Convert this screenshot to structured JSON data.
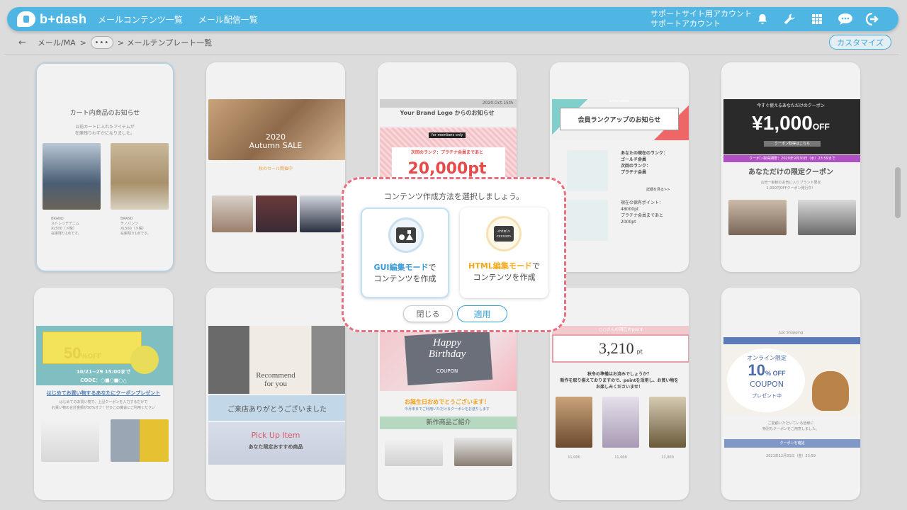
{
  "app": {
    "logo_text": "b+dash",
    "nav": [
      "メールコンテンツ一覧",
      "メール配信一覧"
    ],
    "account_line1": "サポートサイト用アカウント",
    "account_line2": "サポートアカウント",
    "icons": [
      "bell-icon",
      "wrench-icon",
      "grid-icon",
      "chat-icon",
      "logout-icon"
    ]
  },
  "breadcrumb": {
    "back": "←",
    "item1": "メール/MA",
    "sep": ">",
    "more": "•••",
    "current": "> メールテンプレート一覧",
    "customize_label": "カスタマイズ"
  },
  "cards": {
    "c1": {
      "title": "カート内商品のお知らせ",
      "sub": "以前カートに入れたアイテムが\n在庫残りわずかになりました。",
      "brand1": "BRAND\nストレッチデニム\nXL500（メ税）\n在庫残り1点です。",
      "brand2": "BRAND\nチノパンツ\nXL500（メ税）\n在庫残り1点です。"
    },
    "c2": {
      "banner": "2020\nAutumn SALE",
      "sub": "秋のセール開催中"
    },
    "c3": {
      "date": "2020.Oct.15th",
      "logo": "Your Brand Logo からのお知らせ",
      "members": "for members only",
      "rank": "次回のランク：プラチナ会員まであと",
      "points": "20,000pt"
    },
    "c4": {
      "info": "information",
      "title": "会員ランクアップのお知らせ",
      "rank_text": "あなたの現在のランク：\nゴールド会員\n次回のランク：\nプラチナ会員",
      "detail": "詳細を見る>>",
      "points_text": "現在の保有ポイント：\n48000pt\nプラチナ会員まであと\n2000pt"
    },
    "c5": {
      "top": "今すぐ使えるあなただけのクーポン",
      "amount": "¥1,000",
      "off": "OFF",
      "get": "クーポン取得はこちら",
      "deadline": "クーポン取得期限：2020年9月30日（水）23:59まで",
      "title": "あなただけの限定クーポン",
      "sub": "山田一郎様のお気に入りブランド限定\n1,000円OFFクーポン発行中！"
    },
    "c6": {
      "coupon": "WELCOME COUPON",
      "pct": "50",
      "off": "%OFF",
      "date": "10/21~29 15:00まで",
      "code": "CODE：○■○■○△",
      "title": "はじめてお買い物するあなたにクーポンプレゼント",
      "sub": "はじめてのお買い物で、上記クーポンを入力するだけで\nお買い物の合計金額が50%オフ！ぜひこの機会にご利用ください"
    },
    "c7": {
      "rec": "Recommend\nfor you",
      "thanks": "ご来店ありがとうございました",
      "pick": "Pick Up Item",
      "sub": "あなた限定おすすめ商品"
    },
    "c8": {
      "happy": "Happy\nBirthday",
      "coupon": "COUPON",
      "msg": "お誕生日おめでとうございます！",
      "msg2": "今月末までご利用いただけるクーポンをお送りします",
      "new": "新作商品ご紹介"
    },
    "c9": {
      "head": "○○さんの現在のpoint",
      "points": "3,210",
      "unit": "pt",
      "sub": "秋冬の準備はお済みでしょうか？\n新作を取り揃えておりますので、pointを活用し、お買い物を\nお楽しみくださいませ！",
      "price": "11,000"
    },
    "c10": {
      "shop": "Just Shopping",
      "online": "オンライン限定",
      "pct": "10",
      "off": "% OFF",
      "coupon": "COUPON",
      "present": "プレゼント中",
      "sub": "ご愛顧いただいている皆様に\n特別なクーポンをご用意しました。",
      "btn": "クーポンを確認",
      "date": "2021年12月31日（金）23:59"
    }
  },
  "modal": {
    "title": "コンテンツ作成方法を選択しましょう。",
    "gui_highlight": "GUI編集モード",
    "gui_rest": "で",
    "gui_line2": "コンテンツを作成",
    "html_highlight": "HTML編集モード",
    "html_rest": "で",
    "html_line2": "コンテンツを作成",
    "html_icon_text": "<html>\n<xxxxx>",
    "close_label": "閉じる",
    "apply_label": "適用"
  },
  "colors": {
    "header": "#4fb6e4",
    "accent": "#3a9bd6",
    "html_accent": "#f3a91d",
    "modal_border": "#e86f7e"
  }
}
